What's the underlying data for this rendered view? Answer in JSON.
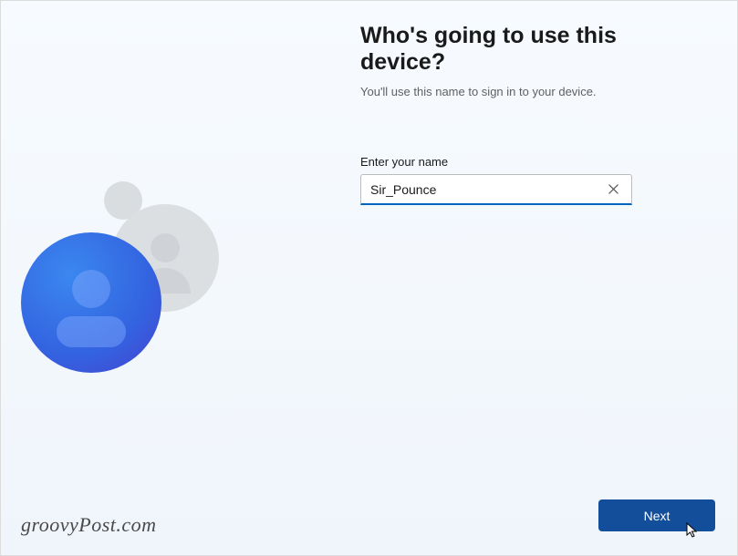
{
  "heading": "Who's going to use this device?",
  "subheading": "You'll use this name to sign in to your device.",
  "field_label": "Enter your name",
  "name_input": {
    "value": "Sir_Pounce",
    "placeholder": ""
  },
  "next_button": "Next",
  "watermark": "groovyPost.com",
  "colors": {
    "accent": "#0067c0",
    "button": "#134e9b"
  }
}
